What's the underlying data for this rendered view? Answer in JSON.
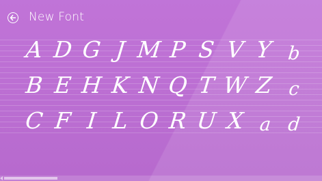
{
  "app": {
    "title": "New Font"
  },
  "icons": {
    "back": "back-arrow-icon"
  },
  "colors": {
    "background": "#be6ed6",
    "glyph": "#ffffff"
  },
  "glyph_rows": [
    [
      "A",
      "D",
      "G",
      "J",
      "M",
      "P",
      "S",
      "V",
      "Y",
      "b"
    ],
    [
      "B",
      "E",
      "H",
      "K",
      "N",
      "Q",
      "T",
      "W",
      "Z",
      "c"
    ],
    [
      "C",
      "F",
      "I",
      "L",
      "O",
      "R",
      "U",
      "X",
      "a",
      "d"
    ]
  ]
}
